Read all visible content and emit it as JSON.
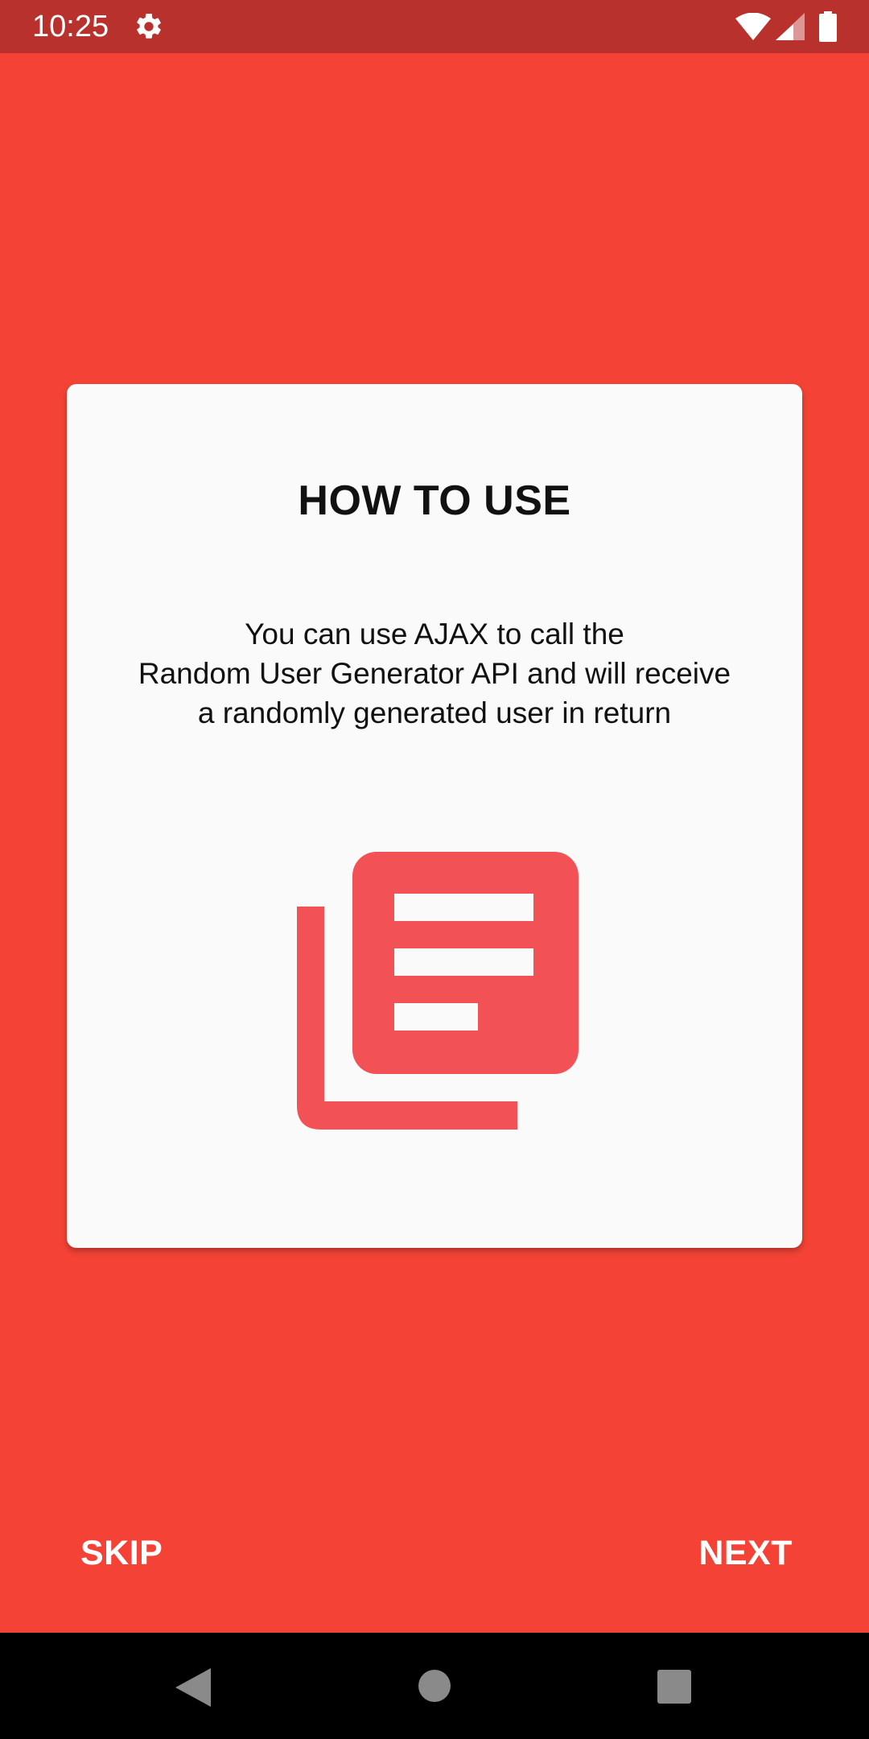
{
  "colors": {
    "background": "#f44336",
    "status_bar": "#b8312c",
    "card": "#fafafa",
    "icon_accent": "#f25255"
  },
  "status_bar": {
    "time": "10:25",
    "icons": [
      "settings-gear-icon",
      "wifi-icon",
      "cell-signal-icon",
      "battery-icon"
    ]
  },
  "card": {
    "title": "HOW TO USE",
    "body_lines": [
      "You can use AJAX to call the",
      "Random User Generator API and will receive",
      "a randomly generated user in return"
    ],
    "illustration_icon": "library-books-icon"
  },
  "actions": {
    "skip_label": "SKIP",
    "next_label": "NEXT"
  },
  "nav_bar": {
    "icons": [
      "back-icon",
      "home-icon",
      "recents-icon"
    ]
  }
}
